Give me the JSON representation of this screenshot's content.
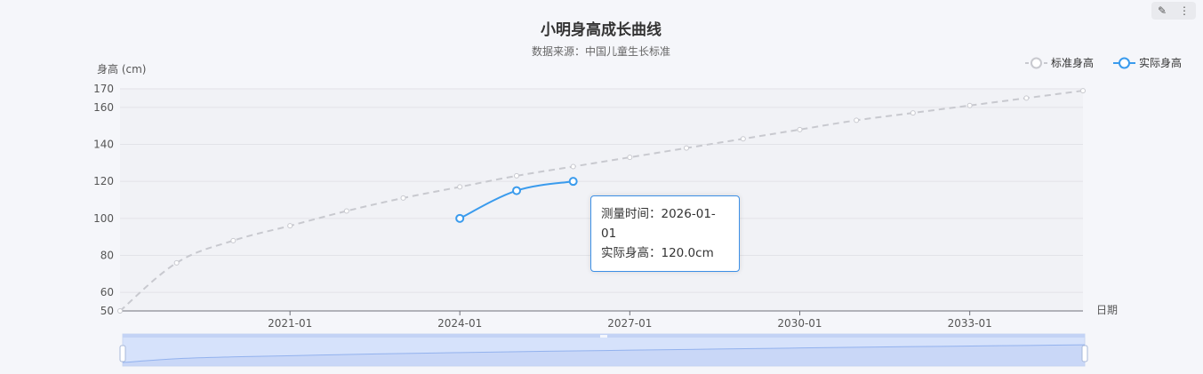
{
  "toolbar": {
    "edit_icon": "✎",
    "more_icon": "⋮"
  },
  "tooltip": {
    "line1_label": "测量时间：",
    "line1_value": "2026-01-01",
    "line2_label": "实际身高：",
    "line2_value": "120.0cm"
  },
  "chart_data": {
    "type": "line",
    "title": "小明身高成长曲线",
    "subtitle": "数据来源：中国儿童生长标准",
    "ylabel": "身高 (cm)",
    "xlabel": "日期",
    "ylim": [
      50,
      170
    ],
    "yticks": [
      50,
      60,
      80,
      100,
      120,
      140,
      160,
      170
    ],
    "xlim": [
      "2018-01-01",
      "2035-01-01"
    ],
    "xticks": [
      {
        "date": "2021-01-01",
        "label": "2021-01"
      },
      {
        "date": "2024-01-01",
        "label": "2024-01"
      },
      {
        "date": "2027-01-01",
        "label": "2027-01"
      },
      {
        "date": "2030-01-01",
        "label": "2030-01"
      },
      {
        "date": "2033-01-01",
        "label": "2033-01"
      }
    ],
    "legend_position": "top-right",
    "grid": true,
    "colors": {
      "standard": "#c8c9cf",
      "actual": "#3a9bed"
    },
    "series": [
      {
        "name": "标准身高",
        "style": "dashed",
        "points": [
          {
            "x": "2018-01-01",
            "y": 50
          },
          {
            "x": "2019-01-01",
            "y": 76
          },
          {
            "x": "2020-01-01",
            "y": 88
          },
          {
            "x": "2021-01-01",
            "y": 96
          },
          {
            "x": "2022-01-01",
            "y": 104
          },
          {
            "x": "2023-01-01",
            "y": 111
          },
          {
            "x": "2024-01-01",
            "y": 117
          },
          {
            "x": "2025-01-01",
            "y": 123
          },
          {
            "x": "2026-01-01",
            "y": 128
          },
          {
            "x": "2027-01-01",
            "y": 133
          },
          {
            "x": "2028-01-01",
            "y": 138
          },
          {
            "x": "2029-01-01",
            "y": 143
          },
          {
            "x": "2030-01-01",
            "y": 148
          },
          {
            "x": "2031-01-01",
            "y": 153
          },
          {
            "x": "2032-01-01",
            "y": 157
          },
          {
            "x": "2033-01-01",
            "y": 161
          },
          {
            "x": "2034-01-01",
            "y": 165
          },
          {
            "x": "2035-01-01",
            "y": 169
          }
        ]
      },
      {
        "name": "实际身高",
        "style": "solid",
        "points": [
          {
            "x": "2024-01-01",
            "y": 100
          },
          {
            "x": "2025-01-01",
            "y": 115
          },
          {
            "x": "2026-01-01",
            "y": 120
          }
        ]
      }
    ]
  }
}
